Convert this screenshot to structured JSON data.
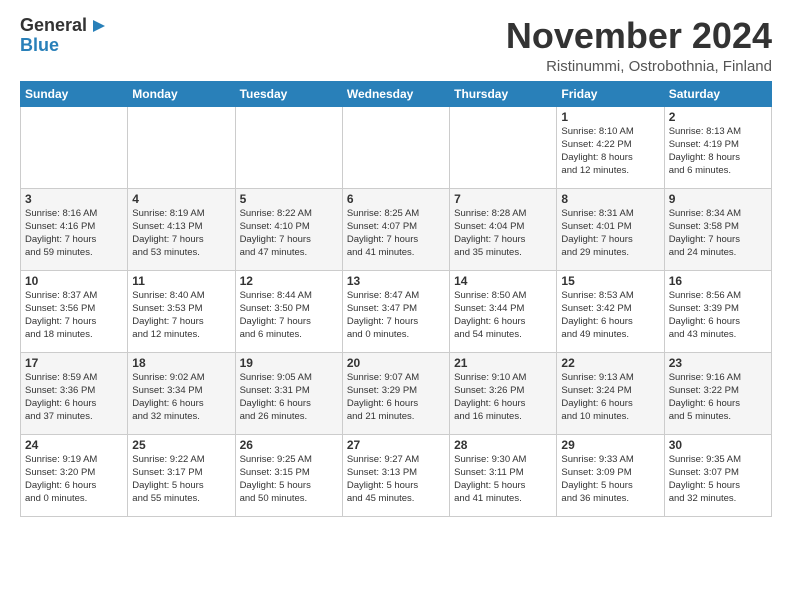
{
  "header": {
    "logo_line1": "General",
    "logo_line2": "Blue",
    "month_title": "November 2024",
    "location": "Ristinummi, Ostrobothnia, Finland"
  },
  "weekdays": [
    "Sunday",
    "Monday",
    "Tuesday",
    "Wednesday",
    "Thursday",
    "Friday",
    "Saturday"
  ],
  "weeks": [
    [
      {
        "day": "",
        "info": ""
      },
      {
        "day": "",
        "info": ""
      },
      {
        "day": "",
        "info": ""
      },
      {
        "day": "",
        "info": ""
      },
      {
        "day": "",
        "info": ""
      },
      {
        "day": "1",
        "info": "Sunrise: 8:10 AM\nSunset: 4:22 PM\nDaylight: 8 hours\nand 12 minutes."
      },
      {
        "day": "2",
        "info": "Sunrise: 8:13 AM\nSunset: 4:19 PM\nDaylight: 8 hours\nand 6 minutes."
      }
    ],
    [
      {
        "day": "3",
        "info": "Sunrise: 8:16 AM\nSunset: 4:16 PM\nDaylight: 7 hours\nand 59 minutes."
      },
      {
        "day": "4",
        "info": "Sunrise: 8:19 AM\nSunset: 4:13 PM\nDaylight: 7 hours\nand 53 minutes."
      },
      {
        "day": "5",
        "info": "Sunrise: 8:22 AM\nSunset: 4:10 PM\nDaylight: 7 hours\nand 47 minutes."
      },
      {
        "day": "6",
        "info": "Sunrise: 8:25 AM\nSunset: 4:07 PM\nDaylight: 7 hours\nand 41 minutes."
      },
      {
        "day": "7",
        "info": "Sunrise: 8:28 AM\nSunset: 4:04 PM\nDaylight: 7 hours\nand 35 minutes."
      },
      {
        "day": "8",
        "info": "Sunrise: 8:31 AM\nSunset: 4:01 PM\nDaylight: 7 hours\nand 29 minutes."
      },
      {
        "day": "9",
        "info": "Sunrise: 8:34 AM\nSunset: 3:58 PM\nDaylight: 7 hours\nand 24 minutes."
      }
    ],
    [
      {
        "day": "10",
        "info": "Sunrise: 8:37 AM\nSunset: 3:56 PM\nDaylight: 7 hours\nand 18 minutes."
      },
      {
        "day": "11",
        "info": "Sunrise: 8:40 AM\nSunset: 3:53 PM\nDaylight: 7 hours\nand 12 minutes."
      },
      {
        "day": "12",
        "info": "Sunrise: 8:44 AM\nSunset: 3:50 PM\nDaylight: 7 hours\nand 6 minutes."
      },
      {
        "day": "13",
        "info": "Sunrise: 8:47 AM\nSunset: 3:47 PM\nDaylight: 7 hours\nand 0 minutes."
      },
      {
        "day": "14",
        "info": "Sunrise: 8:50 AM\nSunset: 3:44 PM\nDaylight: 6 hours\nand 54 minutes."
      },
      {
        "day": "15",
        "info": "Sunrise: 8:53 AM\nSunset: 3:42 PM\nDaylight: 6 hours\nand 49 minutes."
      },
      {
        "day": "16",
        "info": "Sunrise: 8:56 AM\nSunset: 3:39 PM\nDaylight: 6 hours\nand 43 minutes."
      }
    ],
    [
      {
        "day": "17",
        "info": "Sunrise: 8:59 AM\nSunset: 3:36 PM\nDaylight: 6 hours\nand 37 minutes."
      },
      {
        "day": "18",
        "info": "Sunrise: 9:02 AM\nSunset: 3:34 PM\nDaylight: 6 hours\nand 32 minutes."
      },
      {
        "day": "19",
        "info": "Sunrise: 9:05 AM\nSunset: 3:31 PM\nDaylight: 6 hours\nand 26 minutes."
      },
      {
        "day": "20",
        "info": "Sunrise: 9:07 AM\nSunset: 3:29 PM\nDaylight: 6 hours\nand 21 minutes."
      },
      {
        "day": "21",
        "info": "Sunrise: 9:10 AM\nSunset: 3:26 PM\nDaylight: 6 hours\nand 16 minutes."
      },
      {
        "day": "22",
        "info": "Sunrise: 9:13 AM\nSunset: 3:24 PM\nDaylight: 6 hours\nand 10 minutes."
      },
      {
        "day": "23",
        "info": "Sunrise: 9:16 AM\nSunset: 3:22 PM\nDaylight: 6 hours\nand 5 minutes."
      }
    ],
    [
      {
        "day": "24",
        "info": "Sunrise: 9:19 AM\nSunset: 3:20 PM\nDaylight: 6 hours\nand 0 minutes."
      },
      {
        "day": "25",
        "info": "Sunrise: 9:22 AM\nSunset: 3:17 PM\nDaylight: 5 hours\nand 55 minutes."
      },
      {
        "day": "26",
        "info": "Sunrise: 9:25 AM\nSunset: 3:15 PM\nDaylight: 5 hours\nand 50 minutes."
      },
      {
        "day": "27",
        "info": "Sunrise: 9:27 AM\nSunset: 3:13 PM\nDaylight: 5 hours\nand 45 minutes."
      },
      {
        "day": "28",
        "info": "Sunrise: 9:30 AM\nSunset: 3:11 PM\nDaylight: 5 hours\nand 41 minutes."
      },
      {
        "day": "29",
        "info": "Sunrise: 9:33 AM\nSunset: 3:09 PM\nDaylight: 5 hours\nand 36 minutes."
      },
      {
        "day": "30",
        "info": "Sunrise: 9:35 AM\nSunset: 3:07 PM\nDaylight: 5 hours\nand 32 minutes."
      }
    ]
  ]
}
